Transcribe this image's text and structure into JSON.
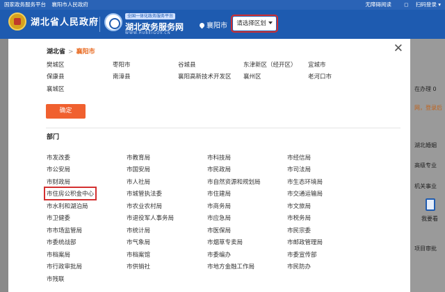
{
  "topbar": {
    "links": [
      "国家政务服务平台",
      "襄阳市人民政府"
    ],
    "accessibility": "无障碍阅读",
    "scan_login": "扫码登录"
  },
  "header": {
    "gov_title": "湖北省人民政府",
    "service_badge": "全国一体化政务服务平台",
    "service_title": "湖北政务服务网",
    "service_url": "WWW.HUBEIGOV.CN",
    "location": "襄阳市",
    "region_button": "请选择区划"
  },
  "background": {
    "items": [
      "在办理 0",
      "网，登录后",
      "湖北婚姻",
      "高级专业",
      "机关事业",
      "我要看",
      "项目审批"
    ]
  },
  "dialog": {
    "breadcrumb_root": "湖北省",
    "breadcrumb_sep": ">",
    "breadcrumb_current": "襄阳市",
    "districts": [
      "樊城区",
      "枣阳市",
      "谷城县",
      "东津新区（经开区）",
      "宜城市",
      "保康县",
      "南漳县",
      "襄阳高新技术开发区",
      "襄州区",
      "老河口市",
      "襄城区"
    ],
    "confirm_label": "确定",
    "dept_title": "部门",
    "departments": [
      "市发改委",
      "市教育局",
      "市科技局",
      "市经信局",
      "市公安局",
      "市国安局",
      "市民政局",
      "市司法局",
      "市财政局",
      "市人社局",
      "市自然资源和规划局",
      "市生态环境局",
      "市住房公积金中心",
      "市城管执法委",
      "市住建局",
      "市交通运输局",
      "市水利和湖泊局",
      "市农业农村局",
      "市商务局",
      "市文旅局",
      "市卫健委",
      "市退役军人事务局",
      "市应急局",
      "市税务局",
      "市市场监管局",
      "市统计局",
      "市医保局",
      "市民宗委",
      "市委统战部",
      "市气象局",
      "市烟草专卖局",
      "市邮政管理局",
      "市档案局",
      "市档案馆",
      "市委编办",
      "市委宣传部",
      "市行政审批局",
      "市供销社",
      "市地方金融工作局",
      "市民防办",
      "市残联"
    ]
  }
}
